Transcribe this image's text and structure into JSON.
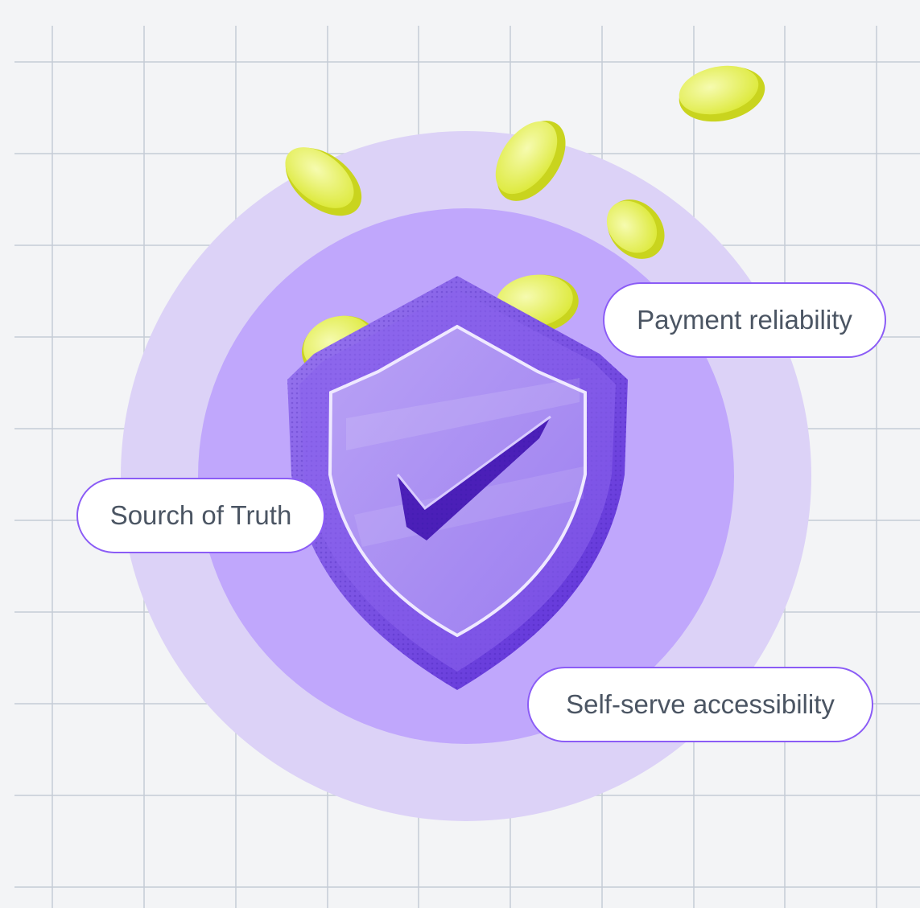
{
  "colors": {
    "background": "#f3f4f6",
    "grid": "#c5cbd6",
    "outer_circle": "#dcd2f7",
    "inner_circle": "#c0a7fc",
    "shield_dark": "#6d3fe0",
    "shield_light": "#a98bf2",
    "coin": "#e8f24a",
    "pill_border": "#8b5cf6",
    "pill_text": "#4b5563"
  },
  "icons": [
    "shield-check-icon",
    "coin-icon"
  ],
  "labels": {
    "payment": "Payment reliability",
    "source": "Sourch of Truth",
    "selfserve": "Self-serve accessibility"
  }
}
